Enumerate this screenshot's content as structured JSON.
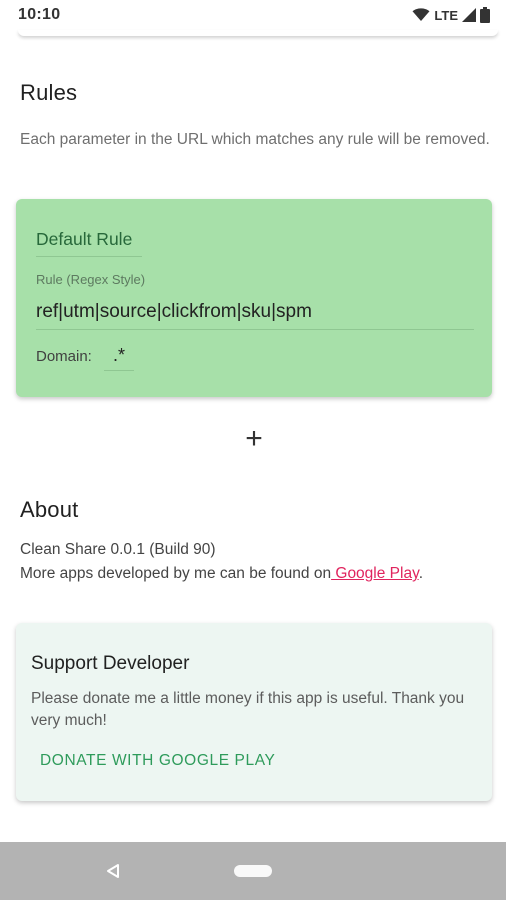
{
  "status_bar": {
    "time": "10:10",
    "network": "LTE"
  },
  "rules": {
    "title": "Rules",
    "description": "Each parameter in the URL which matches any rule will be removed.",
    "card": {
      "name": "Default Rule",
      "rule_label": "Rule (Regex Style)",
      "rule_value": "ref|utm|source|clickfrom|sku|spm",
      "domain_label": "Domain:",
      "domain_value": ".*",
      "color": "#a7e0a9"
    },
    "add_label": "+"
  },
  "about": {
    "title": "About",
    "version_text": "Clean Share 0.0.1 (Build 90)",
    "more_apps_prefix": "More apps developed by me can be found on",
    "link_text": " Google Play",
    "suffix": ".",
    "link_color": "#e0245e"
  },
  "support": {
    "title": "Support Developer",
    "text": "Please donate me a little money if this app is useful. Thank you very much!",
    "donate_label": "DONATE WITH GOOGLE PLAY",
    "accent": "#2e9b5b"
  },
  "nav": {
    "back_icon": "back-triangle-icon",
    "home_icon": "home-pill-icon"
  }
}
